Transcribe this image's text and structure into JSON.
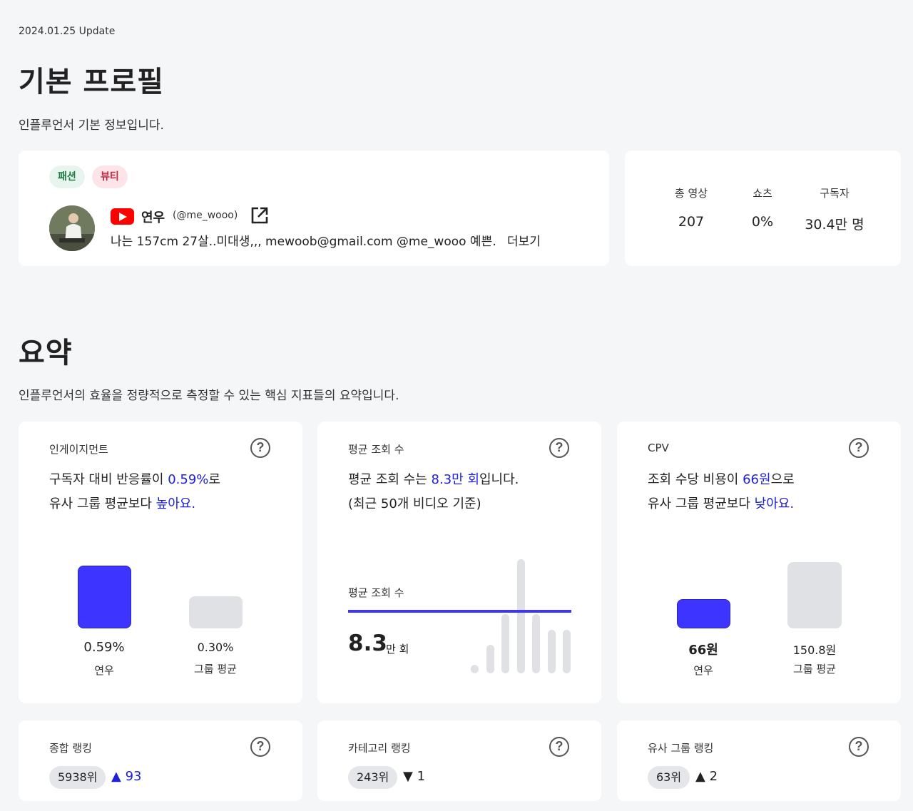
{
  "update_text": "2024.01.25 Update",
  "profile_section": {
    "title": "기본 프로필",
    "subtitle": "인플루언서 기본 정보입니다.",
    "tags": [
      "패션",
      "뷰티"
    ],
    "name": "연우",
    "handle": "(@me_wooo)",
    "bio": "나는 157cm 27살..미대생,,, mewoob@gmail.com @me_wooo 예쁜…",
    "more_label": "더보기",
    "stats": [
      {
        "label": "총 영상",
        "value": "207"
      },
      {
        "label": "쇼츠",
        "value": "0%"
      },
      {
        "label": "구독자",
        "value": "30.4만 명"
      }
    ]
  },
  "summary_section": {
    "title": "요약",
    "subtitle": "인플루언서의 효율을 정량적으로 측정할 수 있는 핵심 지표들의 요약입니다."
  },
  "engagement": {
    "title": "인게이지먼트",
    "line1_prefix": "구독자 대비 반응률이 ",
    "line1_value": "0.59%",
    "line1_suffix": "로",
    "line2_prefix": "유사 그룹 평균보다 ",
    "line2_value": "높아요.",
    "self_value": "0.59%",
    "self_fraction": 0.59,
    "self_label": "연우",
    "group_value": "0.30%",
    "group_fraction": 0.3,
    "group_label": "그룹 평균"
  },
  "avg_views": {
    "title": "평균 조회 수",
    "line1_prefix": "평균 조회 수는 ",
    "line1_value": "8.3만 회",
    "line1_suffix": "입니다.",
    "line2": "(최근 50개 비디오 기준)",
    "chart_label": "평균 조회 수",
    "value_num": "8.3",
    "value_unit": "만 회",
    "bars": [
      0.05,
      0.25,
      0.52,
      1.0,
      0.52,
      0.38,
      0.38
    ]
  },
  "cpv": {
    "title": "CPV",
    "line1_prefix": "조회 수당 비용이 ",
    "line1_value": "66원",
    "line1_suffix": "으로",
    "line2_prefix": "유사 그룹 평균보다 ",
    "line2_value": "낮아요.",
    "self_value": "66원",
    "self_num": 66,
    "self_label": "연우",
    "group_value": "150.8원",
    "group_num": 150.8,
    "group_label": "그룹 평균"
  },
  "rankings": [
    {
      "title": "종합 랭킹",
      "rank": "5938위",
      "change": "▲ 93",
      "direction": "up-blue"
    },
    {
      "title": "카테고리 랭킹",
      "rank": "243위",
      "change": "▼ 1",
      "direction": "down"
    },
    {
      "title": "유사 그룹 랭킹",
      "rank": "63위",
      "change": "▲ 2",
      "direction": "up"
    }
  ],
  "colors": {
    "accent": "#3d35ff",
    "text_blue": "#2020d8",
    "bar_gray": "#dfe1e5"
  }
}
